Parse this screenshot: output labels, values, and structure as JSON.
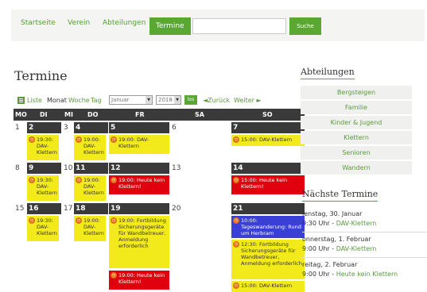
{
  "nav": {
    "items": [
      "Startseite",
      "Verein",
      "Abteilungen",
      "Termine"
    ],
    "search_placeholder": "",
    "search_button": "Suche"
  },
  "page_title": "Termine",
  "toolbar": {
    "list": "Liste",
    "month": "Monat",
    "week": "Woche",
    "day": "Tag",
    "month_select": "Januar",
    "year_select": "2018",
    "ok": "los",
    "back": "◄Zurück",
    "forward": "Weiter ►"
  },
  "calendar": {
    "weekdays": [
      "MO",
      "DI",
      "MI",
      "DO",
      "FR",
      "SA",
      "SO"
    ],
    "weeks": [
      {
        "days": [
          "1",
          "2",
          "3",
          "4",
          "5",
          "6",
          "7"
        ]
      },
      {
        "days": [
          "8",
          "9",
          "10",
          "11",
          "12",
          "13",
          "14"
        ]
      },
      {
        "days": [
          "15",
          "16",
          "17",
          "18",
          "19",
          "20",
          "21"
        ]
      }
    ],
    "events": {
      "w1_di": "19:30: DAV-Klettern",
      "w1_do": "19:00: DAV-Klettern",
      "w1_fr": "19:00: DAV-Klettern",
      "w1_so": "15:00: DAV-Klettern",
      "w2_di": "19:30: DAV-Klettern",
      "w2_do": "19:00: DAV-Klettern",
      "w2_fr": "19:00: Heute kein Klettern!",
      "w2_so": "15:00: Heute kein Klettern!",
      "w3_di": "19:30: DAV-Klettern",
      "w3_do": "19:00: DAV-Klettern",
      "w3_fr1": "19:00: Fortbildung Sicherungsgeräte für Wandbetreuer, Anmeldung erforderlich",
      "w3_fr2": "19:00: Heute kein Klettern!",
      "w3_so1": "10:00: Tageswanderung: Rund um Herbram",
      "w3_so2": "12:30: Fortbildung Sicherungsgeräte für Wandbetreuer, Anmeldung erforderlich",
      "w3_so3": "15:00: DAV-Klettern"
    }
  },
  "sidebar": {
    "title": "Abteilungen",
    "departments": [
      "Bergsteigen",
      "Familie",
      "Kinder & Jugend",
      "Klettern",
      "Senioren",
      "Wandern"
    ],
    "next_title": "Nächste Termine",
    "next": [
      {
        "date": "ienstag, 30. Januar",
        "time": "9:30 Uhr - ",
        "title": "DAV-Klettern"
      },
      {
        "date": "onnerstag, 1. Februar",
        "time": "9:00 Uhr - ",
        "title": "DAV-Klettern"
      },
      {
        "date": "reitag, 2. Februar",
        "time": "9:00 Uhr - ",
        "title": "Heute kein Klettern"
      }
    ]
  },
  "colors": {
    "accent": "#5aa832",
    "event_yellow": "#f3ea1c",
    "event_red": "#e0000e",
    "event_blue": "#3a3fd6",
    "header_dark": "#3a3a3a"
  },
  "icons": [
    "clock-icon",
    "list-icon"
  ]
}
